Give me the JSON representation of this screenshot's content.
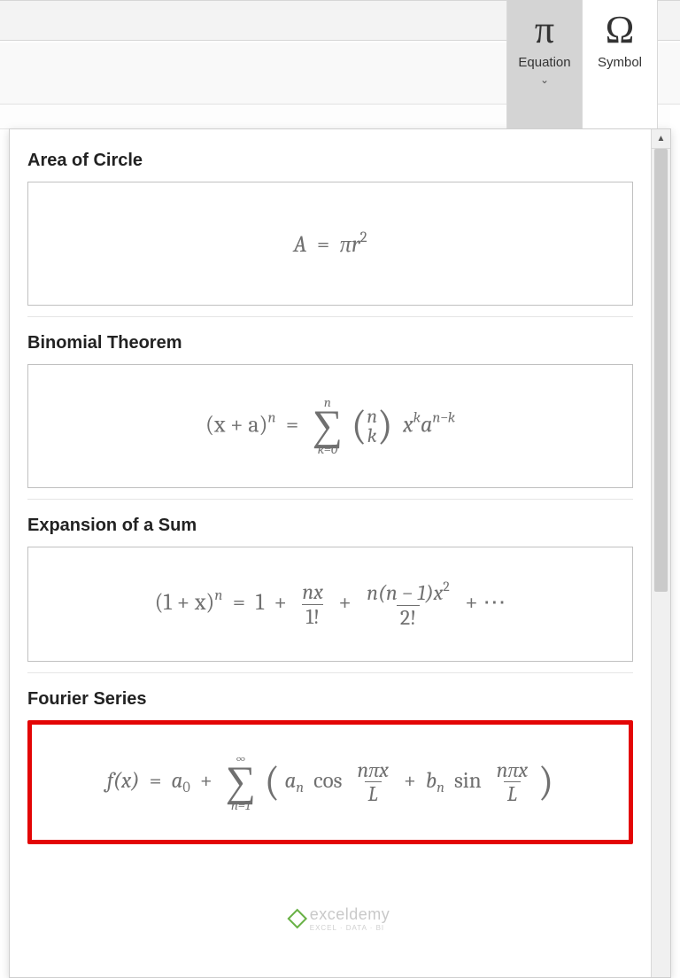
{
  "ribbon": {
    "equation": {
      "label": "Equation",
      "glyph": "π",
      "caret": "⌄"
    },
    "symbol": {
      "label": "Symbol",
      "glyph": "Ω"
    },
    "dialog_launcher": "⌄"
  },
  "gallery": {
    "sections": [
      {
        "title": "Area of Circle"
      },
      {
        "title": "Binomial Theorem"
      },
      {
        "title": "Expansion of a Sum"
      },
      {
        "title": "Fourier Series"
      }
    ]
  },
  "equations": {
    "area_of_circle": {
      "A": "A",
      "eq": "=",
      "pi": "π",
      "r": "r",
      "sq": "2"
    },
    "binomial": {
      "lhs_base": "(x + a)",
      "lhs_exp": "n",
      "eq": "=",
      "sum_top": "n",
      "sum_bot": "k=0",
      "binom_top": "n",
      "binom_bot": "k",
      "term1_base": "x",
      "term1_exp": "k",
      "term2_base": "a",
      "term2_exp": "n−k"
    },
    "expansion": {
      "lhs_base": "(1 + x)",
      "lhs_exp": "n",
      "eq": "=",
      "t0": "1",
      "plus": "+",
      "f1_num": "nx",
      "f1_den": "1!",
      "f2_num": "n(n − 1)x",
      "f2_num_exp": "2",
      "f2_den": "2!",
      "dots": "⋯"
    },
    "fourier": {
      "fx": "f(x)",
      "eq": "=",
      "a0_base": "a",
      "a0_sub": "0",
      "plus": "+",
      "sum_top": "∞",
      "sum_bot": "n=1",
      "an_base": "a",
      "an_sub": "n",
      "cos": "cos",
      "frac_num": "nπx",
      "frac_den": "L",
      "bn_base": "b",
      "bn_sub": "n",
      "sin": "sin"
    }
  },
  "watermark": {
    "text": "exceldemy",
    "tagline": "EXCEL · DATA · BI"
  }
}
